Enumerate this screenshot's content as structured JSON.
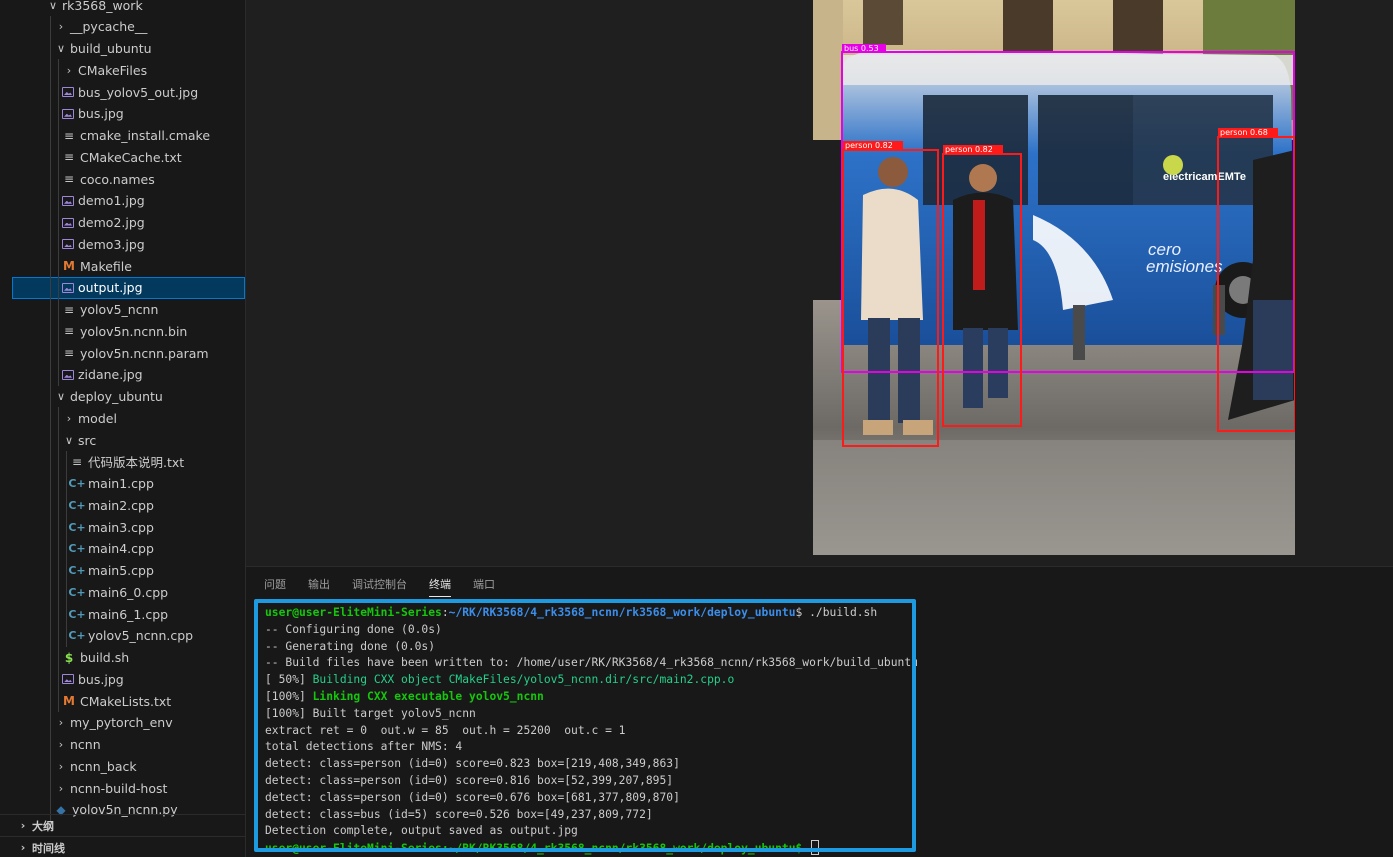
{
  "explorer": {
    "items": [
      {
        "label": "rk3568_work",
        "chevron": "∨",
        "icon": "",
        "indent": 0
      },
      {
        "label": "__pycache__",
        "chevron": "›",
        "icon": "",
        "indent": 1
      },
      {
        "label": "build_ubuntu",
        "chevron": "∨",
        "icon": "",
        "indent": 1
      },
      {
        "label": "CMakeFiles",
        "chevron": "›",
        "icon": "",
        "indent": 2
      },
      {
        "label": "bus_yolov5_out.jpg",
        "chevron": "",
        "icon": "image",
        "indent": 2
      },
      {
        "label": "bus.jpg",
        "chevron": "",
        "icon": "image",
        "indent": 2
      },
      {
        "label": "cmake_install.cmake",
        "chevron": "",
        "icon": "text",
        "indent": 2
      },
      {
        "label": "CMakeCache.txt",
        "chevron": "",
        "icon": "text",
        "indent": 2
      },
      {
        "label": "coco.names",
        "chevron": "",
        "icon": "text",
        "indent": 2
      },
      {
        "label": "demo1.jpg",
        "chevron": "",
        "icon": "image",
        "indent": 2
      },
      {
        "label": "demo2.jpg",
        "chevron": "",
        "icon": "image",
        "indent": 2
      },
      {
        "label": "demo3.jpg",
        "chevron": "",
        "icon": "image",
        "indent": 2
      },
      {
        "label": "Makefile",
        "chevron": "",
        "icon": "makefile",
        "indent": 2
      },
      {
        "label": "output.jpg",
        "chevron": "",
        "icon": "image",
        "indent": 2,
        "selected": true
      },
      {
        "label": "yolov5_ncnn",
        "chevron": "",
        "icon": "text",
        "indent": 2
      },
      {
        "label": "yolov5n.ncnn.bin",
        "chevron": "",
        "icon": "text",
        "indent": 2
      },
      {
        "label": "yolov5n.ncnn.param",
        "chevron": "",
        "icon": "text",
        "indent": 2
      },
      {
        "label": "zidane.jpg",
        "chevron": "",
        "icon": "image",
        "indent": 2
      },
      {
        "label": "deploy_ubuntu",
        "chevron": "∨",
        "icon": "",
        "indent": 1
      },
      {
        "label": "model",
        "chevron": "›",
        "icon": "",
        "indent": 2
      },
      {
        "label": "src",
        "chevron": "∨",
        "icon": "",
        "indent": 2
      },
      {
        "label": "代码版本说明.txt",
        "chevron": "",
        "icon": "text",
        "indent": 3
      },
      {
        "label": "main1.cpp",
        "chevron": "",
        "icon": "cpp",
        "indent": 3
      },
      {
        "label": "main2.cpp",
        "chevron": "",
        "icon": "cpp",
        "indent": 3
      },
      {
        "label": "main3.cpp",
        "chevron": "",
        "icon": "cpp",
        "indent": 3
      },
      {
        "label": "main4.cpp",
        "chevron": "",
        "icon": "cpp",
        "indent": 3
      },
      {
        "label": "main5.cpp",
        "chevron": "",
        "icon": "cpp",
        "indent": 3
      },
      {
        "label": "main6_0.cpp",
        "chevron": "",
        "icon": "cpp",
        "indent": 3
      },
      {
        "label": "main6_1.cpp",
        "chevron": "",
        "icon": "cpp",
        "indent": 3
      },
      {
        "label": "yolov5_ncnn.cpp",
        "chevron": "",
        "icon": "cpp",
        "indent": 3
      },
      {
        "label": "build.sh",
        "chevron": "",
        "icon": "shell",
        "indent": 2
      },
      {
        "label": "bus.jpg",
        "chevron": "",
        "icon": "image",
        "indent": 2
      },
      {
        "label": "CMakeLists.txt",
        "chevron": "",
        "icon": "cmake",
        "indent": 2
      },
      {
        "label": "my_pytorch_env",
        "chevron": "›",
        "icon": "",
        "indent": 1
      },
      {
        "label": "ncnn",
        "chevron": "›",
        "icon": "",
        "indent": 1
      },
      {
        "label": "ncnn_back",
        "chevron": "›",
        "icon": "",
        "indent": 1
      },
      {
        "label": "ncnn-build-host",
        "chevron": "›",
        "icon": "",
        "indent": 1
      },
      {
        "label": "yolov5n_ncnn.py",
        "chevron": "",
        "icon": "python",
        "indent": 1
      }
    ],
    "outline_label": "大纲",
    "timeline_label": "时间线"
  },
  "preview": {
    "detections": [
      {
        "label": "bus 0.53",
        "color": "#e600e6"
      },
      {
        "label": "person 0.82",
        "color": "#ff1a1a"
      },
      {
        "label": "person 0.82",
        "color": "#ff1a1a"
      },
      {
        "label": "person 0.68",
        "color": "#ff1a1a"
      }
    ],
    "bus_text": [
      "cero",
      "emisiones",
      "eléctricamEMTe"
    ]
  },
  "panel": {
    "tabs": [
      "问题",
      "输出",
      "调试控制台",
      "终端",
      "端口"
    ],
    "active_tab": "终端"
  },
  "terminal": {
    "prompt_user": "user@user-EliteMini-Series",
    "prompt_path": "~/RK/RK3568/4_rk3568_ncnn/rk3568_work/deploy_ubuntu",
    "command": "$ ./build.sh",
    "lines": [
      {
        "text": "-- Configuring done (0.0s)",
        "style": ""
      },
      {
        "text": "-- Generating done (0.0s)",
        "style": ""
      },
      {
        "text": "-- Build files have been written to: /home/user/RK/RK3568/4_rk3568_ncnn/rk3568_work/build_ubuntu",
        "style": ""
      },
      {
        "prefix": "[ 50%] ",
        "text": "Building CXX object CMakeFiles/yolov5_ncnn.dir/src/main2.cpp.o",
        "style": "cyan"
      },
      {
        "prefix": "[100%] ",
        "text": "Linking CXX executable yolov5_ncnn",
        "style": "green-bold"
      },
      {
        "text": "[100%] Built target yolov5_ncnn",
        "style": ""
      },
      {
        "text": "extract ret = 0  out.w = 85  out.h = 25200  out.c = 1",
        "style": ""
      },
      {
        "text": "total detections after NMS: 4",
        "style": ""
      },
      {
        "text": "detect: class=person (id=0) score=0.823 box=[219,408,349,863]",
        "style": ""
      },
      {
        "text": "detect: class=person (id=0) score=0.816 box=[52,399,207,895]",
        "style": ""
      },
      {
        "text": "detect: class=person (id=0) score=0.676 box=[681,377,809,870]",
        "style": ""
      },
      {
        "text": "detect: class=bus (id=5) score=0.526 box=[49,237,809,772]",
        "style": ""
      },
      {
        "text": "Detection complete, output saved as output.jpg",
        "style": ""
      }
    ],
    "final_prompt": "user@user-EliteMini-Series:~/RK/RK3568/4_rk3568_ncnn/rk3568_work/deploy_ubuntu$ "
  },
  "colors": {
    "accent": "#0078d4",
    "highlight_box": "#1e9be0",
    "selected_bg": "#04395e"
  }
}
